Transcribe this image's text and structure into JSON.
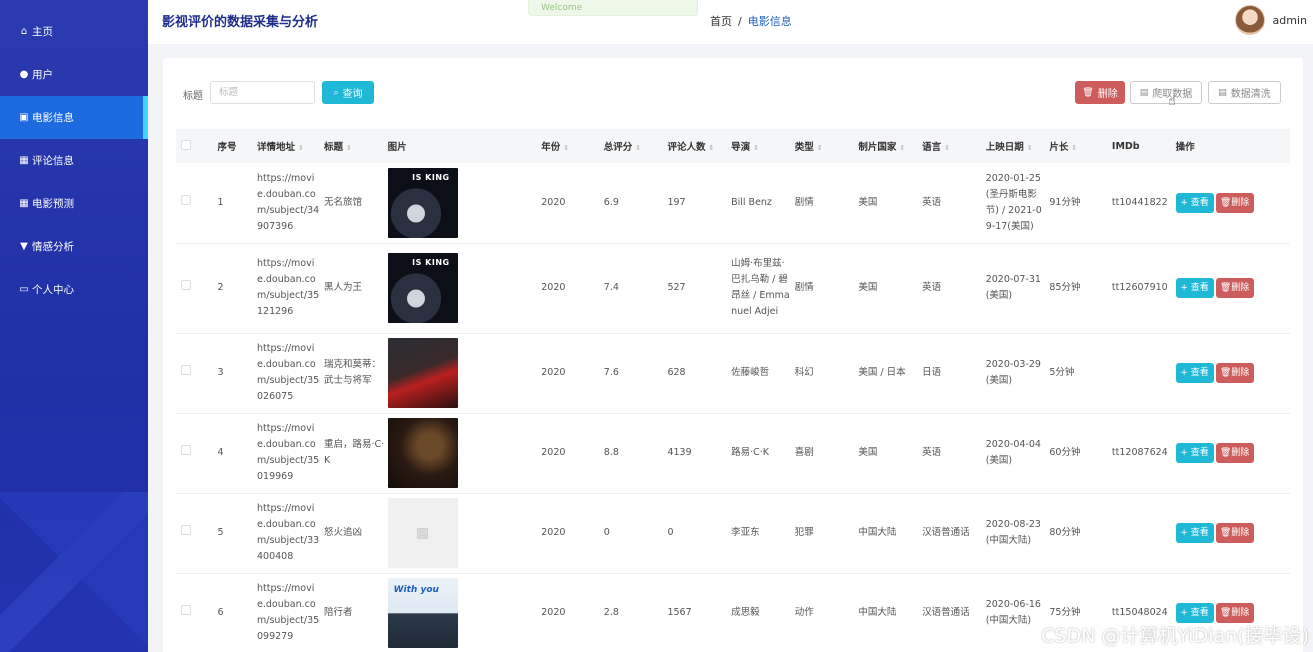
{
  "header": {
    "app_title": "影视评价的数据采集与分析",
    "breadcrumb_home": "首页",
    "breadcrumb_sep": "/",
    "breadcrumb_current": "电影信息",
    "toast_text": "Welcome",
    "username": "admin"
  },
  "sidebar": {
    "items": [
      {
        "label": "主页",
        "icon": "home-icon"
      },
      {
        "label": "用户",
        "icon": "user-icon"
      },
      {
        "label": "电影信息",
        "icon": "clipboard-icon"
      },
      {
        "label": "评论信息",
        "icon": "grid-icon"
      },
      {
        "label": "电影预测",
        "icon": "grid-icon"
      },
      {
        "label": "情感分析",
        "icon": "trophy-icon"
      },
      {
        "label": "个人中心",
        "icon": "id-card-icon"
      }
    ],
    "active_index": 2
  },
  "toolbar": {
    "search_label": "标题",
    "search_placeholder": "标题",
    "query_label": "查询",
    "delete_label": "删除",
    "crawl_label": "爬取数据",
    "clean_label": "数据清洗"
  },
  "table": {
    "columns": [
      "序号",
      "详情地址",
      "标题",
      "图片",
      "年份",
      "总评分",
      "评论人数",
      "导演",
      "类型",
      "制片国家",
      "语言",
      "上映日期",
      "片长",
      "IMDb",
      "操作"
    ],
    "view_label": "+ 查看",
    "delete_label": "删除",
    "rows": [
      {
        "no": "1",
        "url": "https://movie.douban.com/subject/34907396",
        "title": "无名旅馆",
        "poster_text": "IS KING",
        "year": "2020",
        "score": "6.9",
        "reviews": "197",
        "director": "Bill Benz",
        "genre": "剧情",
        "country": "美国",
        "language": "英语",
        "release": "2020-01-25(圣丹斯电影节) / 2021-09-17(美国)",
        "length": "91分钟",
        "imdb": "tt10441822"
      },
      {
        "no": "2",
        "url": "https://movie.douban.com/subject/35121296",
        "title": "黑人为王",
        "poster_text": "IS KING",
        "year": "2020",
        "score": "7.4",
        "reviews": "527",
        "director": "山姆·布里兹·巴扎乌勒 / 碧昂丝 / Emmanuel Adjei",
        "genre": "剧情",
        "country": "美国",
        "language": "英语",
        "release": "2020-07-31(美国)",
        "length": "85分钟",
        "imdb": "tt12607910"
      },
      {
        "no": "3",
        "url": "https://movie.douban.com/subject/35026075",
        "title": "瑞克和莫蒂：武士与将军",
        "poster_text": "",
        "year": "2020",
        "score": "7.6",
        "reviews": "628",
        "director": "佐藤峻哲",
        "genre": "科幻",
        "country": "美国 / 日本",
        "language": "日语",
        "release": "2020-03-29(美国)",
        "length": "5分钟",
        "imdb": ""
      },
      {
        "no": "4",
        "url": "https://movie.douban.com/subject/35019969",
        "title": "重启，路易·C·K",
        "poster_text": "",
        "year": "2020",
        "score": "8.8",
        "reviews": "4139",
        "director": "路易·C·K",
        "genre": "喜剧",
        "country": "美国",
        "language": "英语",
        "release": "2020-04-04(美国)",
        "length": "60分钟",
        "imdb": "tt12087624"
      },
      {
        "no": "5",
        "url": "https://movie.douban.com/subject/33400408",
        "title": "怒火追凶",
        "poster_text": "",
        "year": "2020",
        "score": "0",
        "reviews": "0",
        "director": "李亚东",
        "genre": "犯罪",
        "country": "中国大陆",
        "language": "汉语普通话",
        "release": "2020-08-23(中国大陆)",
        "length": "80分钟",
        "imdb": ""
      },
      {
        "no": "6",
        "url": "https://movie.douban.com/subject/35099279",
        "title": "陪行者",
        "poster_text": "With you",
        "year": "2020",
        "score": "2.8",
        "reviews": "1567",
        "director": "成思毅",
        "genre": "动作",
        "country": "中国大陆",
        "language": "汉语普通话",
        "release": "2020-06-16(中国大陆)",
        "length": "75分钟",
        "imdb": "tt15048024"
      }
    ]
  },
  "watermark": "CSDN @计算机YiDian(接毕设)",
  "colors": {
    "sidebar": "#2c3ab0",
    "active": "#1e6be0",
    "accent": "#1fb8d6",
    "danger": "#cd5c5c"
  }
}
